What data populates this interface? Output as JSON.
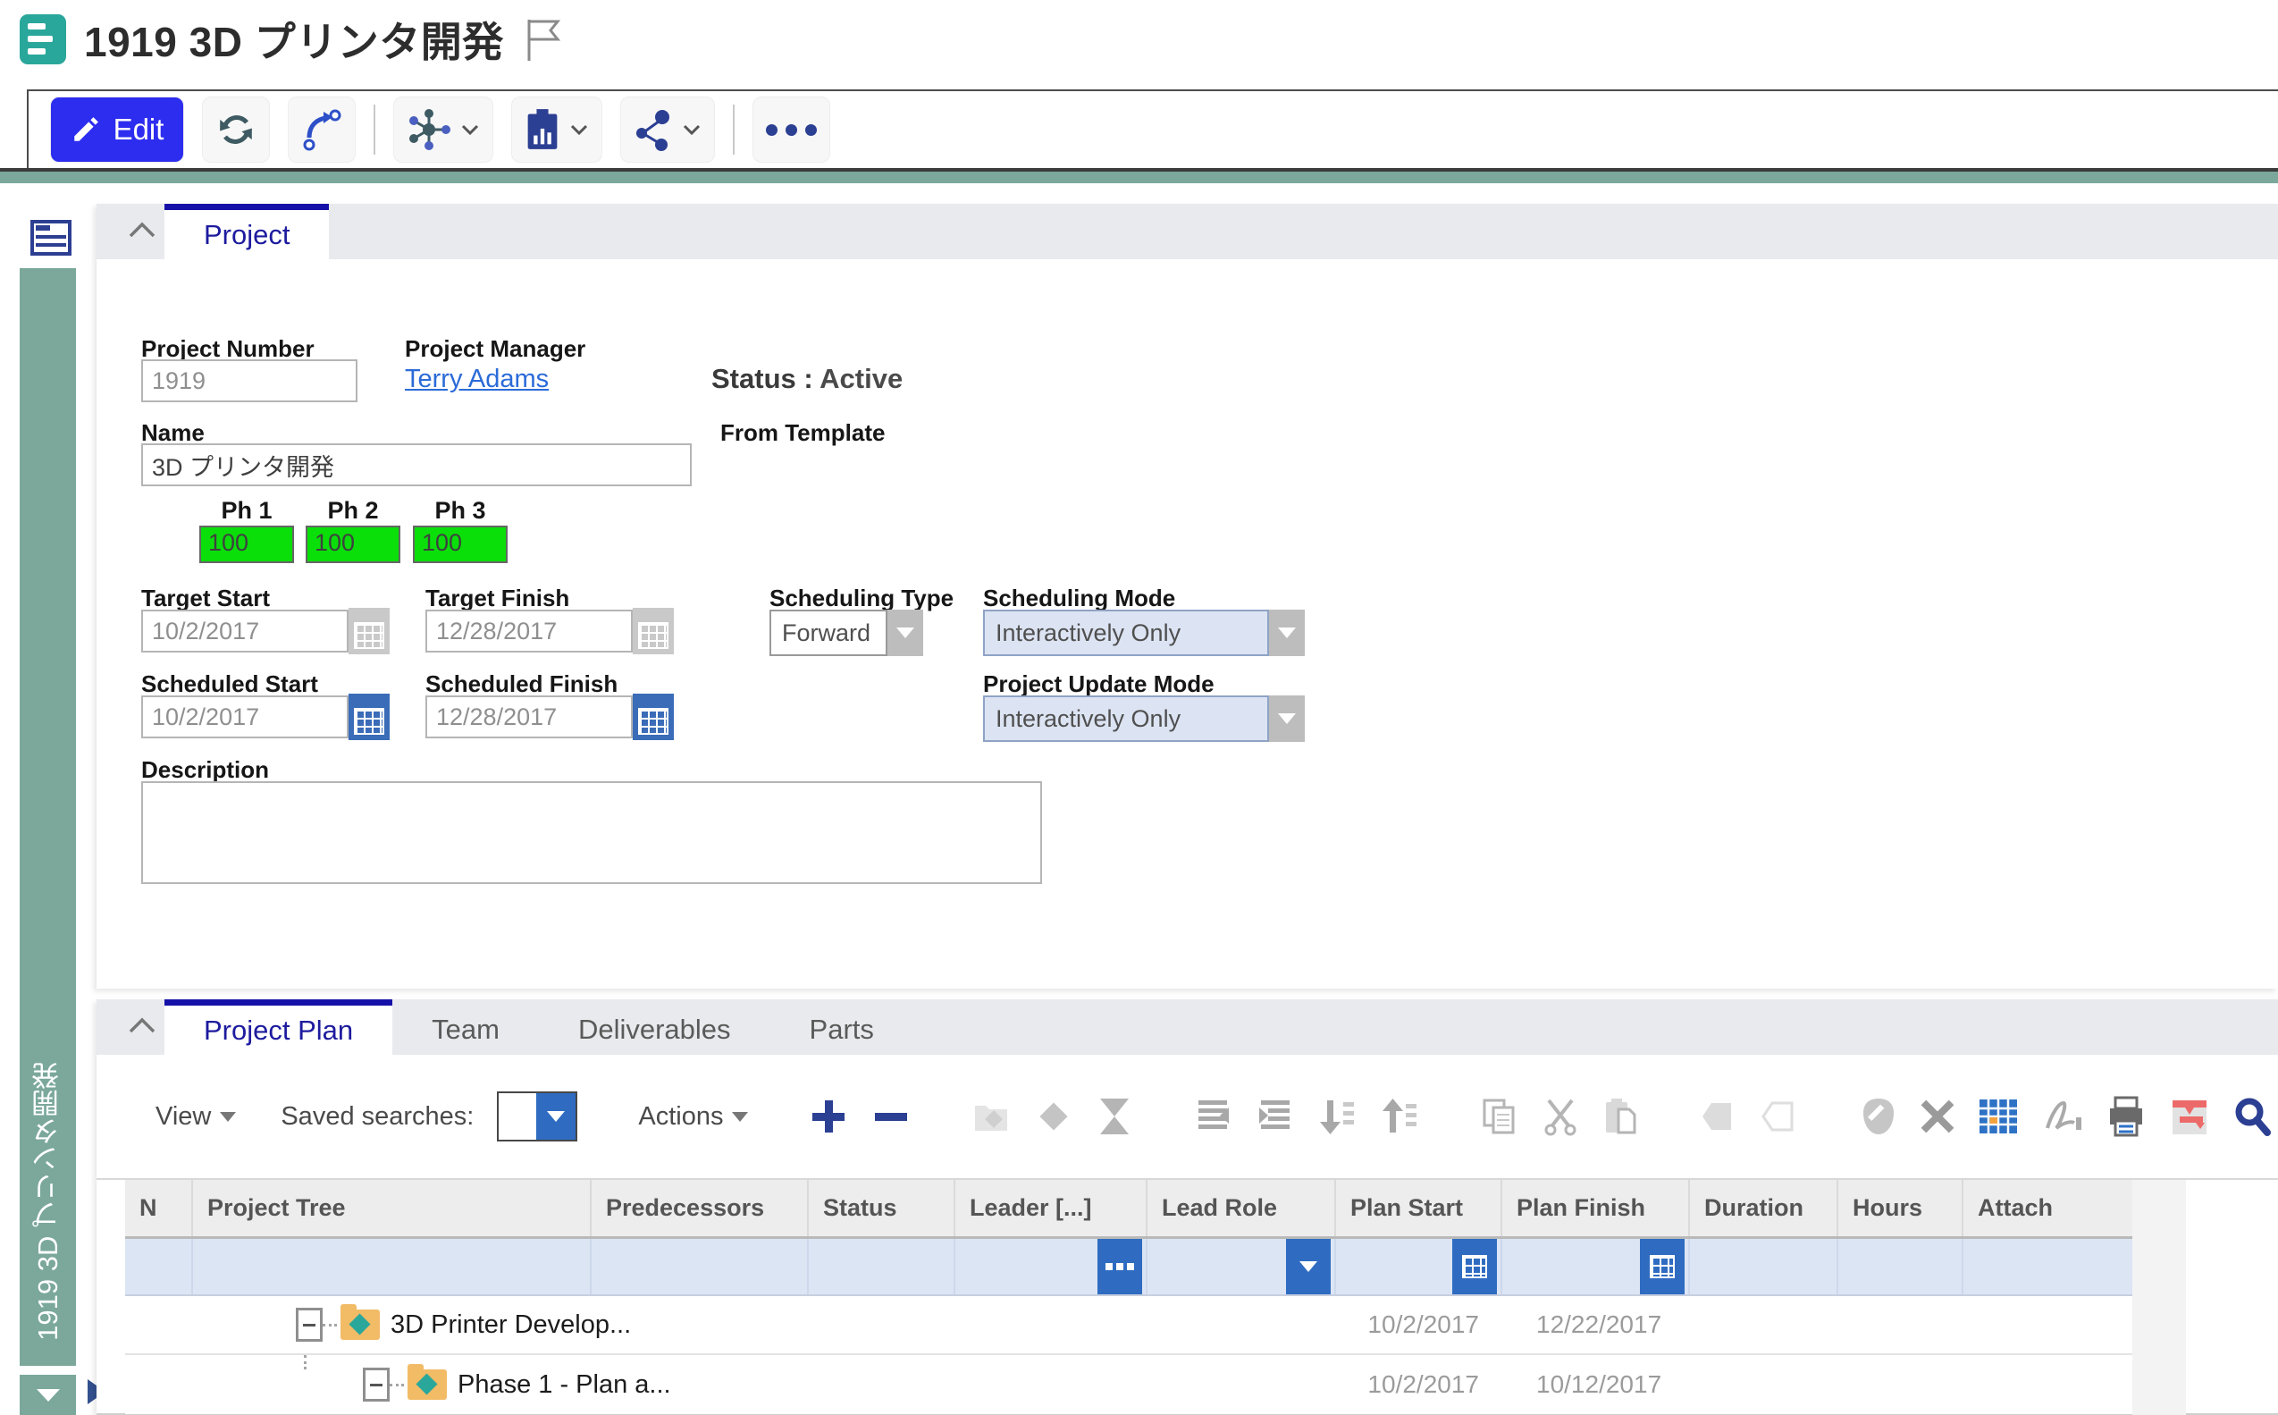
{
  "header": {
    "title": "1919 3D プリンタ開発"
  },
  "main_toolbar": {
    "edit_label": "Edit",
    "icons": [
      "edit-pencil",
      "refresh",
      "route-arrow",
      "network-hub",
      "report-clipboard",
      "share",
      "more-ellipsis",
      "flag"
    ]
  },
  "sidebar": {
    "vertical_title": "1919 3D プリンタ開発",
    "icons": [
      "summary-form",
      "scroll-down-triangle",
      "expand-right-triangle"
    ]
  },
  "project": {
    "tab_label": "Project",
    "fields": {
      "project_number": {
        "label": "Project Number",
        "value": "1919"
      },
      "project_manager": {
        "label": "Project Manager",
        "value": "Terry Adams"
      },
      "status": {
        "label": "Status :",
        "value": "Active"
      },
      "name": {
        "label": "Name",
        "value": "3D プリンタ開発"
      },
      "from_template": {
        "label": "From Template",
        "value": ""
      },
      "phases": {
        "items": [
          {
            "label": "Ph 1",
            "value": "100"
          },
          {
            "label": "Ph 2",
            "value": "100"
          },
          {
            "label": "Ph 3",
            "value": "100"
          }
        ]
      },
      "target_start": {
        "label": "Target Start",
        "value": "10/2/2017"
      },
      "target_finish": {
        "label": "Target Finish",
        "value": "12/28/2017"
      },
      "scheduling_type": {
        "label": "Scheduling Type",
        "value": "Forward"
      },
      "scheduling_mode": {
        "label": "Scheduling Mode",
        "value": "Interactively Only"
      },
      "scheduled_start": {
        "label": "Scheduled Start",
        "value": "10/2/2017"
      },
      "scheduled_finish": {
        "label": "Scheduled Finish",
        "value": "12/28/2017"
      },
      "project_update_mode": {
        "label": "Project Update Mode",
        "value": "Interactively Only"
      },
      "description": {
        "label": "Description",
        "value": ""
      }
    }
  },
  "plan": {
    "tabs": [
      {
        "label": "Project Plan"
      },
      {
        "label": "Team"
      },
      {
        "label": "Deliverables"
      },
      {
        "label": "Parts"
      }
    ],
    "toolbar": {
      "view_label": "View",
      "saved_searches_label": "Saved searches:",
      "actions_label": "Actions",
      "icons": [
        "add",
        "remove",
        "milestone",
        "diamond",
        "hourglass",
        "outdent",
        "indent",
        "move-down",
        "move-up",
        "copy",
        "cut",
        "paste",
        "hexagon-filled",
        "hexagon-outline",
        "edit-oval",
        "delete-x",
        "schedule-table",
        "signature",
        "print",
        "gantt-filter",
        "search",
        "clear-backspace"
      ]
    },
    "table": {
      "columns": [
        "N",
        "Project Tree",
        "Predecessors",
        "Status",
        "Leader [...]",
        "Lead Role",
        "Plan Start",
        "Plan Finish",
        "Duration",
        "Hours",
        "Attach"
      ],
      "rows": [
        {
          "name": "3D Printer Develop...",
          "plan_start": "10/2/2017",
          "plan_finish": "12/22/2017"
        },
        {
          "name": "Phase 1 - Plan a...",
          "plan_start": "10/2/2017",
          "plan_finish": "10/12/2017"
        }
      ]
    }
  },
  "colors": {
    "accent_teal": "#7BA89B",
    "icon_teal": "#2AA79B",
    "edit_blue": "#2D2DF0",
    "icon_navy": "#2B3F93",
    "link_blue": "#2B6BD8",
    "phase_green": "#0ADF0A",
    "filter_button_blue": "#2F6CC1",
    "active_tab_navy": "#1D1B9E",
    "folder_orange": "#F2BB66"
  }
}
